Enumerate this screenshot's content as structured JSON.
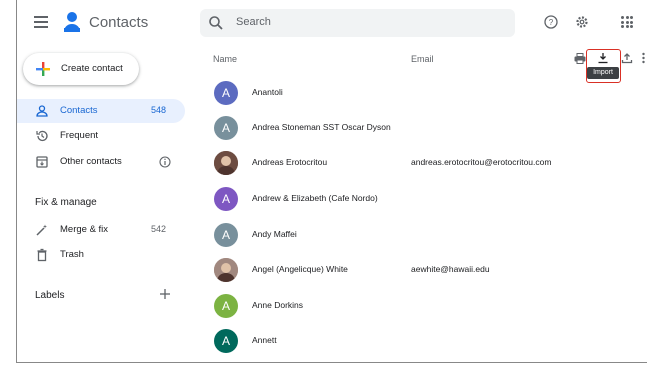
{
  "app": {
    "title": "Contacts"
  },
  "search": {
    "placeholder": "Search"
  },
  "sidebar": {
    "create_label": "Create contact",
    "nav": [
      {
        "label": "Contacts",
        "count": "548",
        "icon": "person-icon",
        "active": true
      },
      {
        "label": "Frequent",
        "count": "",
        "icon": "history-icon"
      },
      {
        "label": "Other contacts",
        "count": "",
        "icon": "archive-icon"
      }
    ],
    "fix_title": "Fix & manage",
    "fix": [
      {
        "label": "Merge & fix",
        "count": "542",
        "icon": "magic-wand-icon"
      },
      {
        "label": "Trash",
        "count": "",
        "icon": "trash-icon"
      }
    ],
    "labels_title": "Labels"
  },
  "table": {
    "name_header": "Name",
    "email_header": "Email",
    "tooltip": "Import",
    "rows": [
      {
        "initial": "A",
        "name": "Anantoli",
        "email": "",
        "color": "#5c6bc0",
        "photo": false
      },
      {
        "initial": "A",
        "name": "Andrea Stoneman SST Oscar Dyson",
        "email": "",
        "color": "#78909c",
        "photo": false
      },
      {
        "initial": "",
        "name": "Andreas Erotocritou",
        "email": "andreas.erotocritou@erotocritou.com",
        "color": "#6d4c41",
        "photo": true
      },
      {
        "initial": "A",
        "name": "Andrew & Elizabeth (Cafe Nordo)",
        "email": "",
        "color": "#7e57c2",
        "photo": false
      },
      {
        "initial": "A",
        "name": "Andy Maffei",
        "email": "",
        "color": "#78909c",
        "photo": false
      },
      {
        "initial": "",
        "name": "Angel (Angelicque) White",
        "email": "aewhite@hawaii.edu",
        "color": "#a1887f",
        "photo": true
      },
      {
        "initial": "A",
        "name": "Anne Dorkins",
        "email": "",
        "color": "#7cb342",
        "photo": false
      },
      {
        "initial": "A",
        "name": "Annett",
        "email": "",
        "color": "#00695c",
        "photo": false
      }
    ]
  }
}
